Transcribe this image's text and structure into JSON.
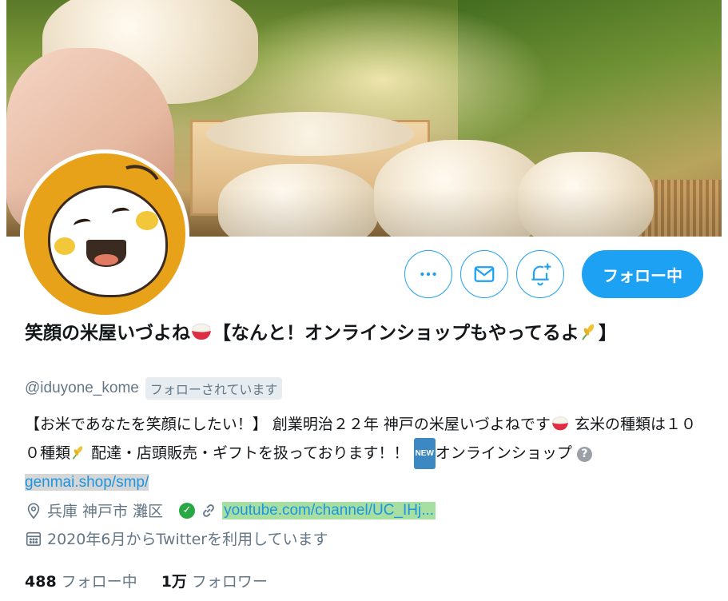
{
  "profile": {
    "display_name_part1": "笑顔の米屋いづよね",
    "display_name_part2": "【なんと！オンラインショップもやってるよ",
    "display_name_part3": "】",
    "handle": "@iduyone_kome",
    "follows_you": "フォローされています"
  },
  "bio": {
    "text1": "【お米であなたを笑顔にしたい！】 創業明治２２年 神戸の米屋いづよねです",
    "text2": " 玄米の種類は１００種類",
    "text3": " 配達・店頭販売・ギフトを扱っております！！ ",
    "new_badge": "NEW",
    "text4": "オンラインショップ ",
    "link": "genmai.shop/smp/"
  },
  "meta": {
    "location": "兵庫 神戸市 灘区",
    "url": "youtube.com/channel/UC_IHj...",
    "joined": "2020年6月からTwitterを利用しています"
  },
  "stats": {
    "following_count": "488",
    "following_label": "フォロー中",
    "followers_count": "1万",
    "followers_label": "フォロワー"
  },
  "actions": {
    "follow_label": "フォロー中"
  },
  "colors": {
    "accent": "#1da1f2",
    "secondary_text": "#657786"
  },
  "icons": [
    "more-icon",
    "mail-icon",
    "bell-plus-icon",
    "location-pin-icon",
    "verified-check-icon",
    "link-icon",
    "calendar-icon",
    "rice-bowl-icon",
    "rice-plant-icon",
    "question-icon"
  ]
}
